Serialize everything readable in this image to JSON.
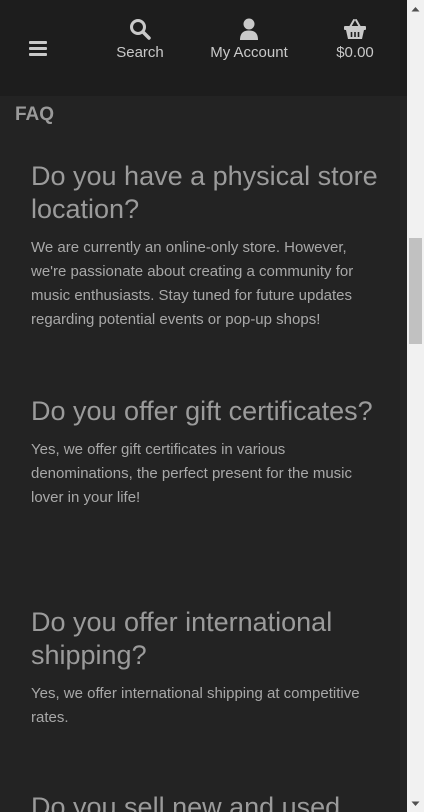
{
  "header": {
    "search_label": "Search",
    "account_label": "My Account",
    "cart_total": "$0.00",
    "icons": {
      "menu": "hamburger-menu-icon",
      "search": "search-icon",
      "account": "user-icon",
      "cart": "basket-icon"
    }
  },
  "page": {
    "section_title": "FAQ"
  },
  "faq": {
    "items": [
      {
        "question": "Do you have a physical store location?",
        "answer": "We are currently an online-only store. However, we're passionate about creating a community for music enthusiasts. Stay tuned for future updates regarding potential events or pop-up shops!"
      },
      {
        "question": "Do you offer gift certificates?",
        "answer": "Yes, we offer gift certificates in various denominations, the perfect present for the music lover in your life!"
      },
      {
        "question": "Do you offer international shipping?",
        "answer": "Yes, we offer international shipping at competitive rates."
      },
      {
        "question": "Do you sell new and used"
      }
    ]
  },
  "colors": {
    "background": "#232323",
    "header_background": "#1d1d1d",
    "text_muted": "#9b9b9b",
    "nav_text": "#c9c9c9"
  }
}
